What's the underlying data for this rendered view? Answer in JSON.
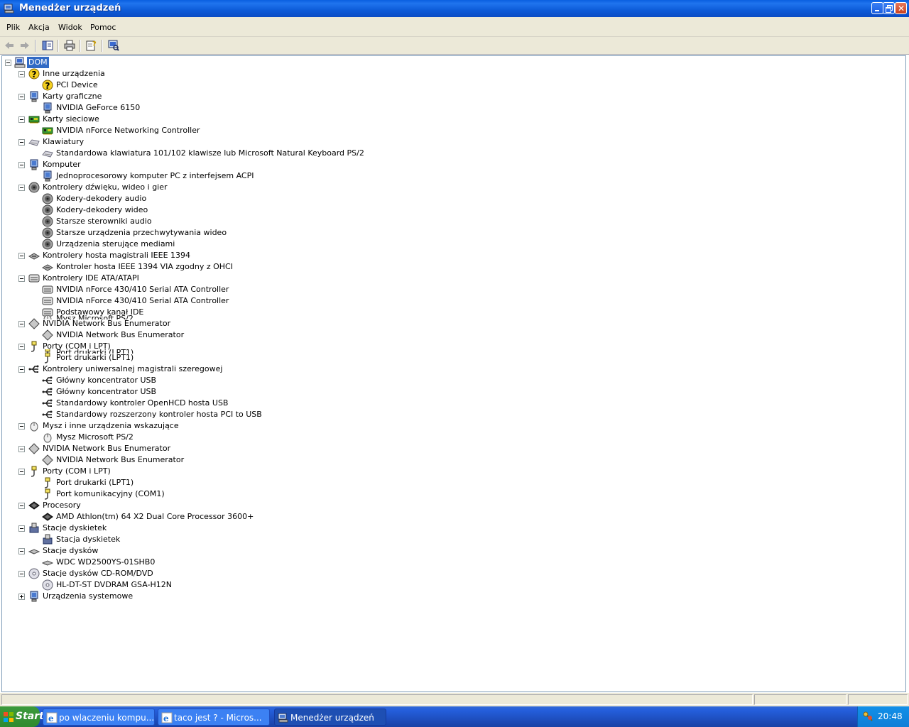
{
  "window": {
    "title": "Menedżer urządzeń"
  },
  "menu": [
    "Plik",
    "Akcja",
    "Widok",
    "Pomoc"
  ],
  "tree": [
    {
      "label": "DOM",
      "icon": "computer-icon",
      "level": 0,
      "selected": true
    },
    {
      "label": "Inne urządzenia",
      "icon": "question-icon",
      "level": 1
    },
    {
      "label": "PCI Device",
      "icon": "question-icon",
      "level": 2
    },
    {
      "label": "Karty graficzne",
      "icon": "monitor-icon",
      "level": 1
    },
    {
      "label": "NVIDIA GeForce 6150",
      "icon": "monitor-icon",
      "level": 2
    },
    {
      "label": "Karty sieciowe",
      "icon": "network-card-icon",
      "level": 1
    },
    {
      "label": "NVIDIA nForce Networking Controller",
      "icon": "network-card-icon",
      "level": 2
    },
    {
      "label": "Klawiatury",
      "icon": "keyboard-icon",
      "level": 1
    },
    {
      "label": "Standardowa klawiatura 101/102 klawisze lub Microsoft Natural Keyboard PS/2",
      "icon": "keyboard-icon",
      "level": 2
    },
    {
      "label": "Komputer",
      "icon": "monitor-icon",
      "level": 1
    },
    {
      "label": "Jednoprocesorowy komputer PC z interfejsem ACPI",
      "icon": "monitor-icon",
      "level": 2
    },
    {
      "label": "Kontrolery dźwięku, wideo i gier",
      "icon": "speaker-icon",
      "level": 1
    },
    {
      "label": "Kodery-dekodery audio",
      "icon": "speaker-icon",
      "level": 2
    },
    {
      "label": "Kodery-dekodery wideo",
      "icon": "speaker-icon",
      "level": 2
    },
    {
      "label": "Starsze sterowniki audio",
      "icon": "speaker-icon",
      "level": 2
    },
    {
      "label": "Starsze urządzenia przechwytywania wideo",
      "icon": "speaker-icon",
      "level": 2
    },
    {
      "label": "Urządzenia sterujące mediami",
      "icon": "speaker-icon",
      "level": 2
    },
    {
      "label": "Kontrolery hosta magistrali IEEE 1394",
      "icon": "controller-icon",
      "level": 1
    },
    {
      "label": "Kontroler hosta IEEE 1394 VIA zgodny z OHCI",
      "icon": "controller-icon",
      "level": 2
    },
    {
      "label": "Kontrolery IDE ATA/ATAPI",
      "icon": "ide-icon",
      "level": 1
    },
    {
      "label": "NVIDIA nForce 430/410 Serial ATA Controller",
      "icon": "ide-icon",
      "level": 2
    },
    {
      "label": "NVIDIA nForce 430/410 Serial ATA Controller",
      "icon": "ide-icon",
      "level": 2
    },
    {
      "label": "Podstawowy kanał IDE",
      "icon": "ide-icon",
      "level": 2
    },
    {
      "label": "NVIDIA Network Bus Enumerator",
      "icon": "diamond-icon",
      "level": 1
    },
    {
      "label": "NVIDIA Network Bus Enumerator",
      "icon": "diamond-icon",
      "level": 2
    },
    {
      "label": "Porty (COM i LPT)",
      "icon": "port-icon",
      "level": 1
    },
    {
      "label": "Port drukarki (LPT1)",
      "icon": "port-icon",
      "level": 2
    },
    {
      "label": "Kontrolery uniwersalnej magistrali szeregowej",
      "icon": "usb-icon",
      "level": 1
    },
    {
      "label": "Główny koncentrator USB",
      "icon": "usb-icon",
      "level": 2
    },
    {
      "label": "Główny koncentrator USB",
      "icon": "usb-icon",
      "level": 2
    },
    {
      "label": "Standardowy kontroler OpenHCD hosta USB",
      "icon": "usb-icon",
      "level": 2
    },
    {
      "label": "Standardowy rozszerzony kontroler hosta PCI to USB",
      "icon": "usb-icon",
      "level": 2
    },
    {
      "label": "Mysz i inne urządzenia wskazujące",
      "icon": "mouse-icon",
      "level": 1
    },
    {
      "label": "Mysz Microsoft PS/2",
      "icon": "mouse-icon",
      "level": 2
    },
    {
      "label": "NVIDIA Network Bus Enumerator",
      "icon": "diamond-icon",
      "level": 1
    },
    {
      "label": "NVIDIA Network Bus Enumerator",
      "icon": "diamond-icon",
      "level": 2
    },
    {
      "label": "Porty (COM i LPT)",
      "icon": "port-icon",
      "level": 1
    },
    {
      "label": "Port drukarki (LPT1)",
      "icon": "port-icon",
      "level": 2
    },
    {
      "label": "Port komunikacyjny (COM1)",
      "icon": "port-icon",
      "level": 2
    },
    {
      "label": "Procesory",
      "icon": "cpu-icon",
      "level": 1
    },
    {
      "label": "AMD Athlon(tm) 64 X2 Dual Core Processor 3600+",
      "icon": "cpu-icon",
      "level": 2
    },
    {
      "label": "Stacje dyskietek",
      "icon": "floppy-icon",
      "level": 1
    },
    {
      "label": "Stacja dyskietek",
      "icon": "floppy-icon",
      "level": 2
    },
    {
      "label": "Stacje dysków",
      "icon": "disk-icon",
      "level": 1
    },
    {
      "label": "WDC WD2500YS-01SHB0",
      "icon": "disk-icon",
      "level": 2
    },
    {
      "label": "Stacje dysków CD-ROM/DVD",
      "icon": "cdrom-icon",
      "level": 1
    },
    {
      "label": "HL-DT-ST DVDRAM GSA-H12N",
      "icon": "cdrom-icon",
      "level": 2
    },
    {
      "label": "Urządzenia systemowe",
      "icon": "monitor-icon",
      "level": 1,
      "collapsed": true
    }
  ],
  "overlap_ghosts": [
    {
      "label": "Mysz Microsoft PS/2",
      "after_index": 22
    },
    {
      "label": "Port drukarki (LPT1)",
      "after_index": 25
    }
  ],
  "taskbar": {
    "start": "Start",
    "tasks": [
      {
        "label": "po wlaczeniu kompu...",
        "icon": "ie-icon"
      },
      {
        "label": "taco jest ? - Micros...",
        "icon": "ie-icon"
      },
      {
        "label": "Menedżer urządzeń",
        "icon": "device-manager-icon",
        "active": true
      }
    ],
    "clock": "20:48"
  }
}
